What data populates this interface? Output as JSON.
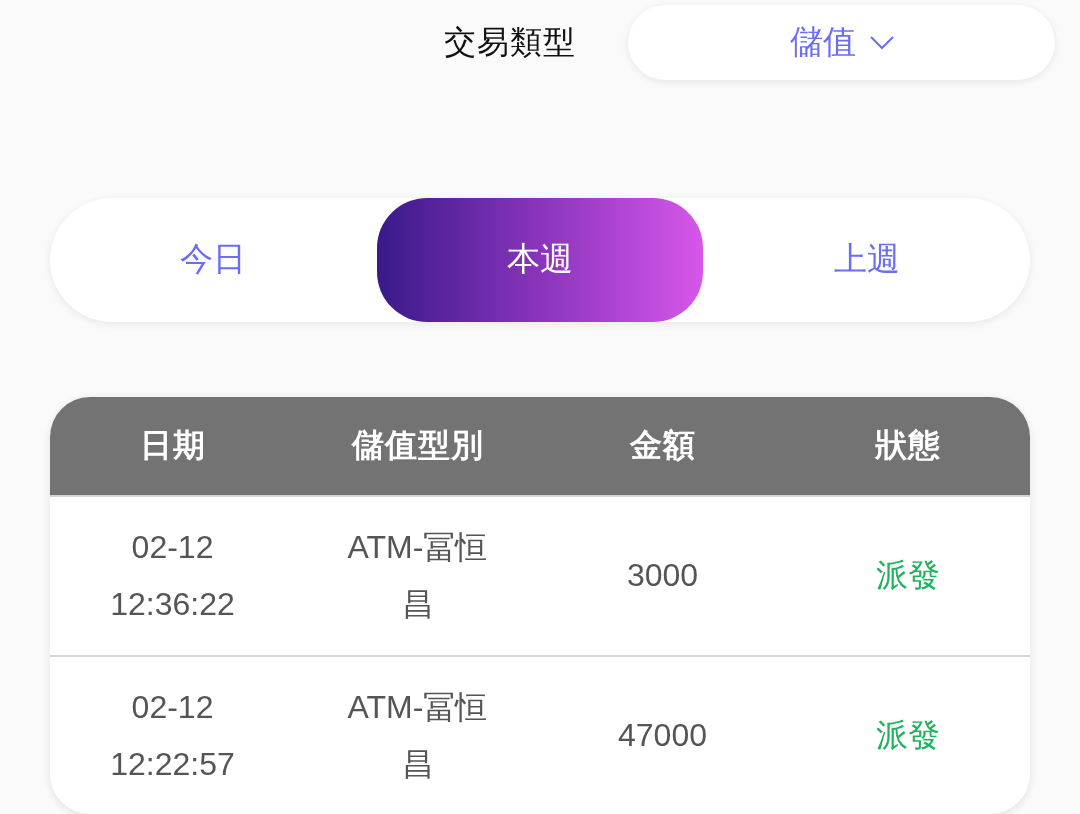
{
  "filter": {
    "label": "交易類型",
    "dropdown": {
      "value": "儲值"
    }
  },
  "periods": [
    {
      "label": "今日",
      "selected": false
    },
    {
      "label": "本週",
      "selected": true
    },
    {
      "label": "上週",
      "selected": false
    }
  ],
  "table": {
    "columns": [
      "日期",
      "儲值型別",
      "金額",
      "狀態"
    ],
    "rows": [
      {
        "date": "02-12 12:36:22",
        "type": "ATM-冨恒昌",
        "amount": "3000",
        "status": "派發"
      },
      {
        "date": "02-12 12:22:57",
        "type": "ATM-冨恒昌",
        "amount": "47000",
        "status": "派發"
      }
    ]
  }
}
